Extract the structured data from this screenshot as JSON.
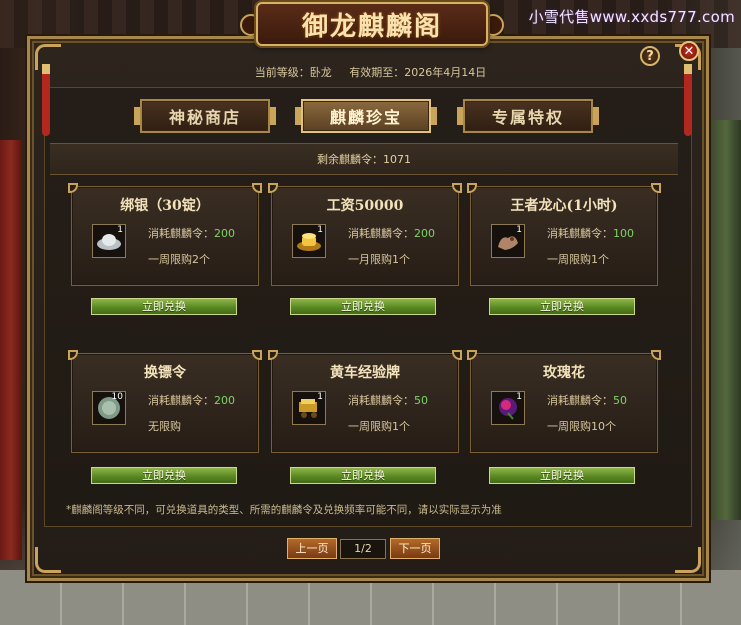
{
  "watermark": "小雪代售www.xxds777.com",
  "window": {
    "title": "御龙麒麟阁",
    "help_label": "?",
    "close_label": "✕"
  },
  "status": {
    "level_label": "当前等级：卧龙",
    "expiry_label": "有效期至：2026年4月14日"
  },
  "tabs": [
    {
      "label": "神秘商店",
      "active": false
    },
    {
      "label": "麒麟珍宝",
      "active": true
    },
    {
      "label": "专属特权",
      "active": false
    }
  ],
  "remaining": "剩余麒麟令：1071",
  "cost_prefix": "消耗麒麟令：",
  "redeem_label": "立即兑换",
  "items": [
    {
      "name": "绑银（30锭）",
      "icon": "silver-ingot-icon",
      "qty": "1",
      "cost": "200",
      "limit": "一周限购2个"
    },
    {
      "name": "工资50000",
      "icon": "gold-ingot-icon",
      "qty": "1",
      "cost": "200",
      "limit": "一月限购1个"
    },
    {
      "name": "王者龙心(1小时)",
      "icon": "dragon-heart-icon",
      "qty": "1",
      "cost": "100",
      "limit": "一周限购1个"
    },
    {
      "name": "换镖令",
      "icon": "escort-token-icon",
      "qty": "10",
      "cost": "200",
      "limit": "无限购"
    },
    {
      "name": "黄车经验牌",
      "icon": "yellow-cart-exp-icon",
      "qty": "1",
      "cost": "50",
      "limit": "一周限购1个"
    },
    {
      "name": "玫瑰花",
      "icon": "rose-icon",
      "qty": "1",
      "cost": "50",
      "limit": "一周限购10个"
    }
  ],
  "footnote": "*麒麟阁等级不同，可兑换道具的类型、所需的麒麟令及兑换频率可能不同，请以实际显示为准",
  "pager": {
    "prev_label": "上一页",
    "page": "1/2",
    "next_label": "下一页"
  }
}
